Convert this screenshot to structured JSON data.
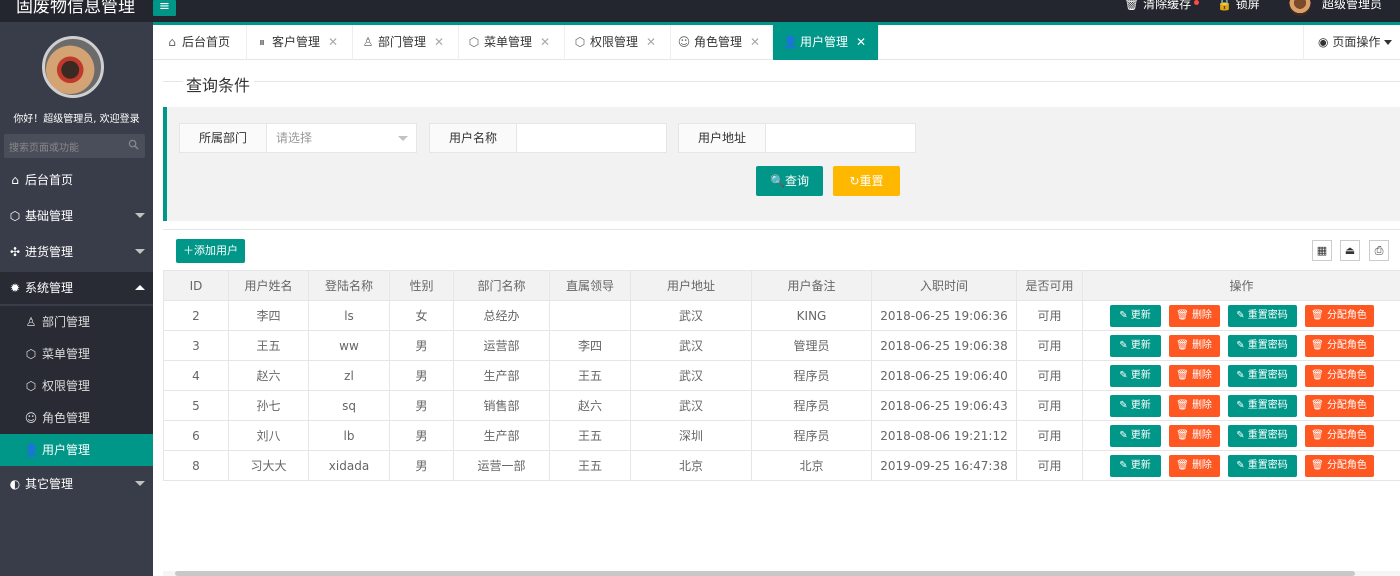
{
  "app": {
    "title": "固废物信息管理"
  },
  "topbar": {
    "menu_toggle": "≡",
    "clear_cache": "清除缓存",
    "lock_screen": "锁屏",
    "user_name": "超级管理员"
  },
  "sidebar": {
    "welcome": "你好！超级管理员, 欢迎登录",
    "search_placeholder": "搜索页面或功能",
    "items": {
      "home": "后台首页",
      "basic": "基础管理",
      "inventory": "进货管理",
      "system": "系统管理",
      "dept": "部门管理",
      "menu": "菜单管理",
      "perm": "权限管理",
      "role": "角色管理",
      "user": "用户管理",
      "other": "其它管理"
    }
  },
  "tabs": [
    {
      "label": "后台首页"
    },
    {
      "label": "客户管理"
    },
    {
      "label": "部门管理"
    },
    {
      "label": "菜单管理"
    },
    {
      "label": "权限管理"
    },
    {
      "label": "角色管理"
    },
    {
      "label": "用户管理"
    }
  ],
  "page_ops": "页面操作",
  "query": {
    "title": "查询条件",
    "dept_label": "所属部门",
    "dept_placeholder": "请选择",
    "name_label": "用户名称",
    "name_value": "",
    "addr_label": "用户地址",
    "addr_value": "",
    "search_btn": "查询",
    "reset_btn": "重置"
  },
  "toolbar": {
    "add_user": "添加用户"
  },
  "table": {
    "headers": [
      "ID",
      "用户姓名",
      "登陆名称",
      "性别",
      "部门名称",
      "直属领导",
      "用户地址",
      "用户备注",
      "入职时间",
      "是否可用",
      "操作"
    ],
    "actions": {
      "update": "更新",
      "delete": "删除",
      "reset_pwd": "重置密码",
      "assign_role": "分配角色"
    },
    "rows": [
      {
        "id": "2",
        "name": "李四",
        "login": "ls",
        "sex": "女",
        "dept": "总经办",
        "leader": "",
        "address": "武汉",
        "remark": "KING",
        "hired": "2018-06-25 19:06:36",
        "available": "可用"
      },
      {
        "id": "3",
        "name": "王五",
        "login": "ww",
        "sex": "男",
        "dept": "运营部",
        "leader": "李四",
        "address": "武汉",
        "remark": "管理员",
        "hired": "2018-06-25 19:06:38",
        "available": "可用"
      },
      {
        "id": "4",
        "name": "赵六",
        "login": "zl",
        "sex": "男",
        "dept": "生产部",
        "leader": "王五",
        "address": "武汉",
        "remark": "程序员",
        "hired": "2018-06-25 19:06:40",
        "available": "可用"
      },
      {
        "id": "5",
        "name": "孙七",
        "login": "sq",
        "sex": "男",
        "dept": "销售部",
        "leader": "赵六",
        "address": "武汉",
        "remark": "程序员",
        "hired": "2018-06-25 19:06:43",
        "available": "可用"
      },
      {
        "id": "6",
        "name": "刘八",
        "login": "lb",
        "sex": "男",
        "dept": "生产部",
        "leader": "王五",
        "address": "深圳",
        "remark": "程序员",
        "hired": "2018-08-06 19:21:12",
        "available": "可用"
      },
      {
        "id": "8",
        "name": "习大大",
        "login": "xidada",
        "sex": "男",
        "dept": "运营一部",
        "leader": "王五",
        "address": "北京",
        "remark": "北京",
        "hired": "2019-09-25 16:47:38",
        "available": "可用"
      }
    ]
  },
  "colors": {
    "accent": "#009688",
    "sidebar": "#393d49",
    "warn": "#ffb800",
    "danger": "#ff5722"
  }
}
